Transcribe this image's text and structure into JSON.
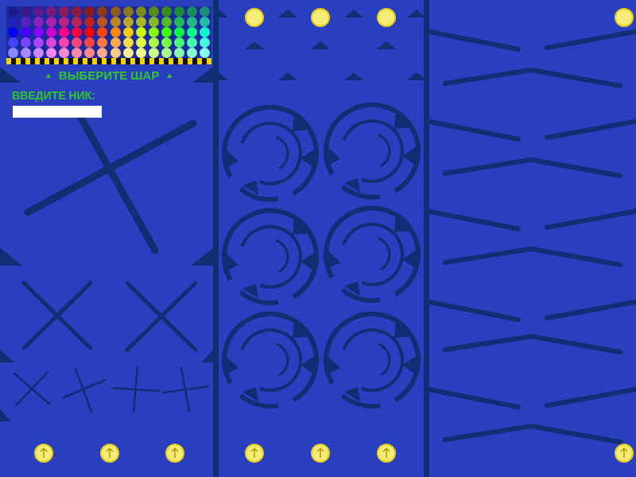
{
  "palette": {
    "colors": [
      "#1a1a8c",
      "#3a1a8c",
      "#5a1a8c",
      "#7a1a7a",
      "#8c1a5a",
      "#8c1a3a",
      "#8c1a1a",
      "#8c3a1a",
      "#8c5a1a",
      "#8c7a1a",
      "#7a8c1a",
      "#5a8c1a",
      "#3a8c1a",
      "#1a8c3a",
      "#1a8c5a",
      "#1a8c7a",
      "#2222bb",
      "#5522bb",
      "#8822bb",
      "#aa22aa",
      "#bb2288",
      "#bb2255",
      "#bb2222",
      "#bb5522",
      "#bb8822",
      "#bbaa22",
      "#aabb22",
      "#88bb22",
      "#55bb22",
      "#22bb55",
      "#22bb88",
      "#22bbaa",
      "#0000ff",
      "#4400ff",
      "#8800ff",
      "#cc00cc",
      "#ff0088",
      "#ff0044",
      "#ff0000",
      "#ff4400",
      "#ff8800",
      "#ffcc00",
      "#ccff00",
      "#88ff00",
      "#44ff00",
      "#00ff44",
      "#00ff88",
      "#00ffcc",
      "#4444ff",
      "#7744ff",
      "#aa44ff",
      "#dd44dd",
      "#ff44aa",
      "#ff4477",
      "#ff4444",
      "#ff7744",
      "#ffaa44",
      "#ffdd44",
      "#ddff44",
      "#aaff44",
      "#77ff44",
      "#44ff77",
      "#44ffaa",
      "#44ffdd",
      "#8888ff",
      "#aa88ff",
      "#cc88ff",
      "#ee88ee",
      "#ff88cc",
      "#ff88aa",
      "#ff8888",
      "#ffaa88",
      "#ffcc88",
      "#ffee88",
      "#eeff88",
      "#ccff88",
      "#aaff88",
      "#88ffaa",
      "#88ffcc",
      "#88ffee"
    ]
  },
  "prompt": {
    "left_arrow": "▲",
    "label": "ВЫБЕРИТЕ ШАР",
    "right_arrow": "▲"
  },
  "nickname": {
    "label": "ВВЕДИТЕ НИК:",
    "value": ""
  }
}
